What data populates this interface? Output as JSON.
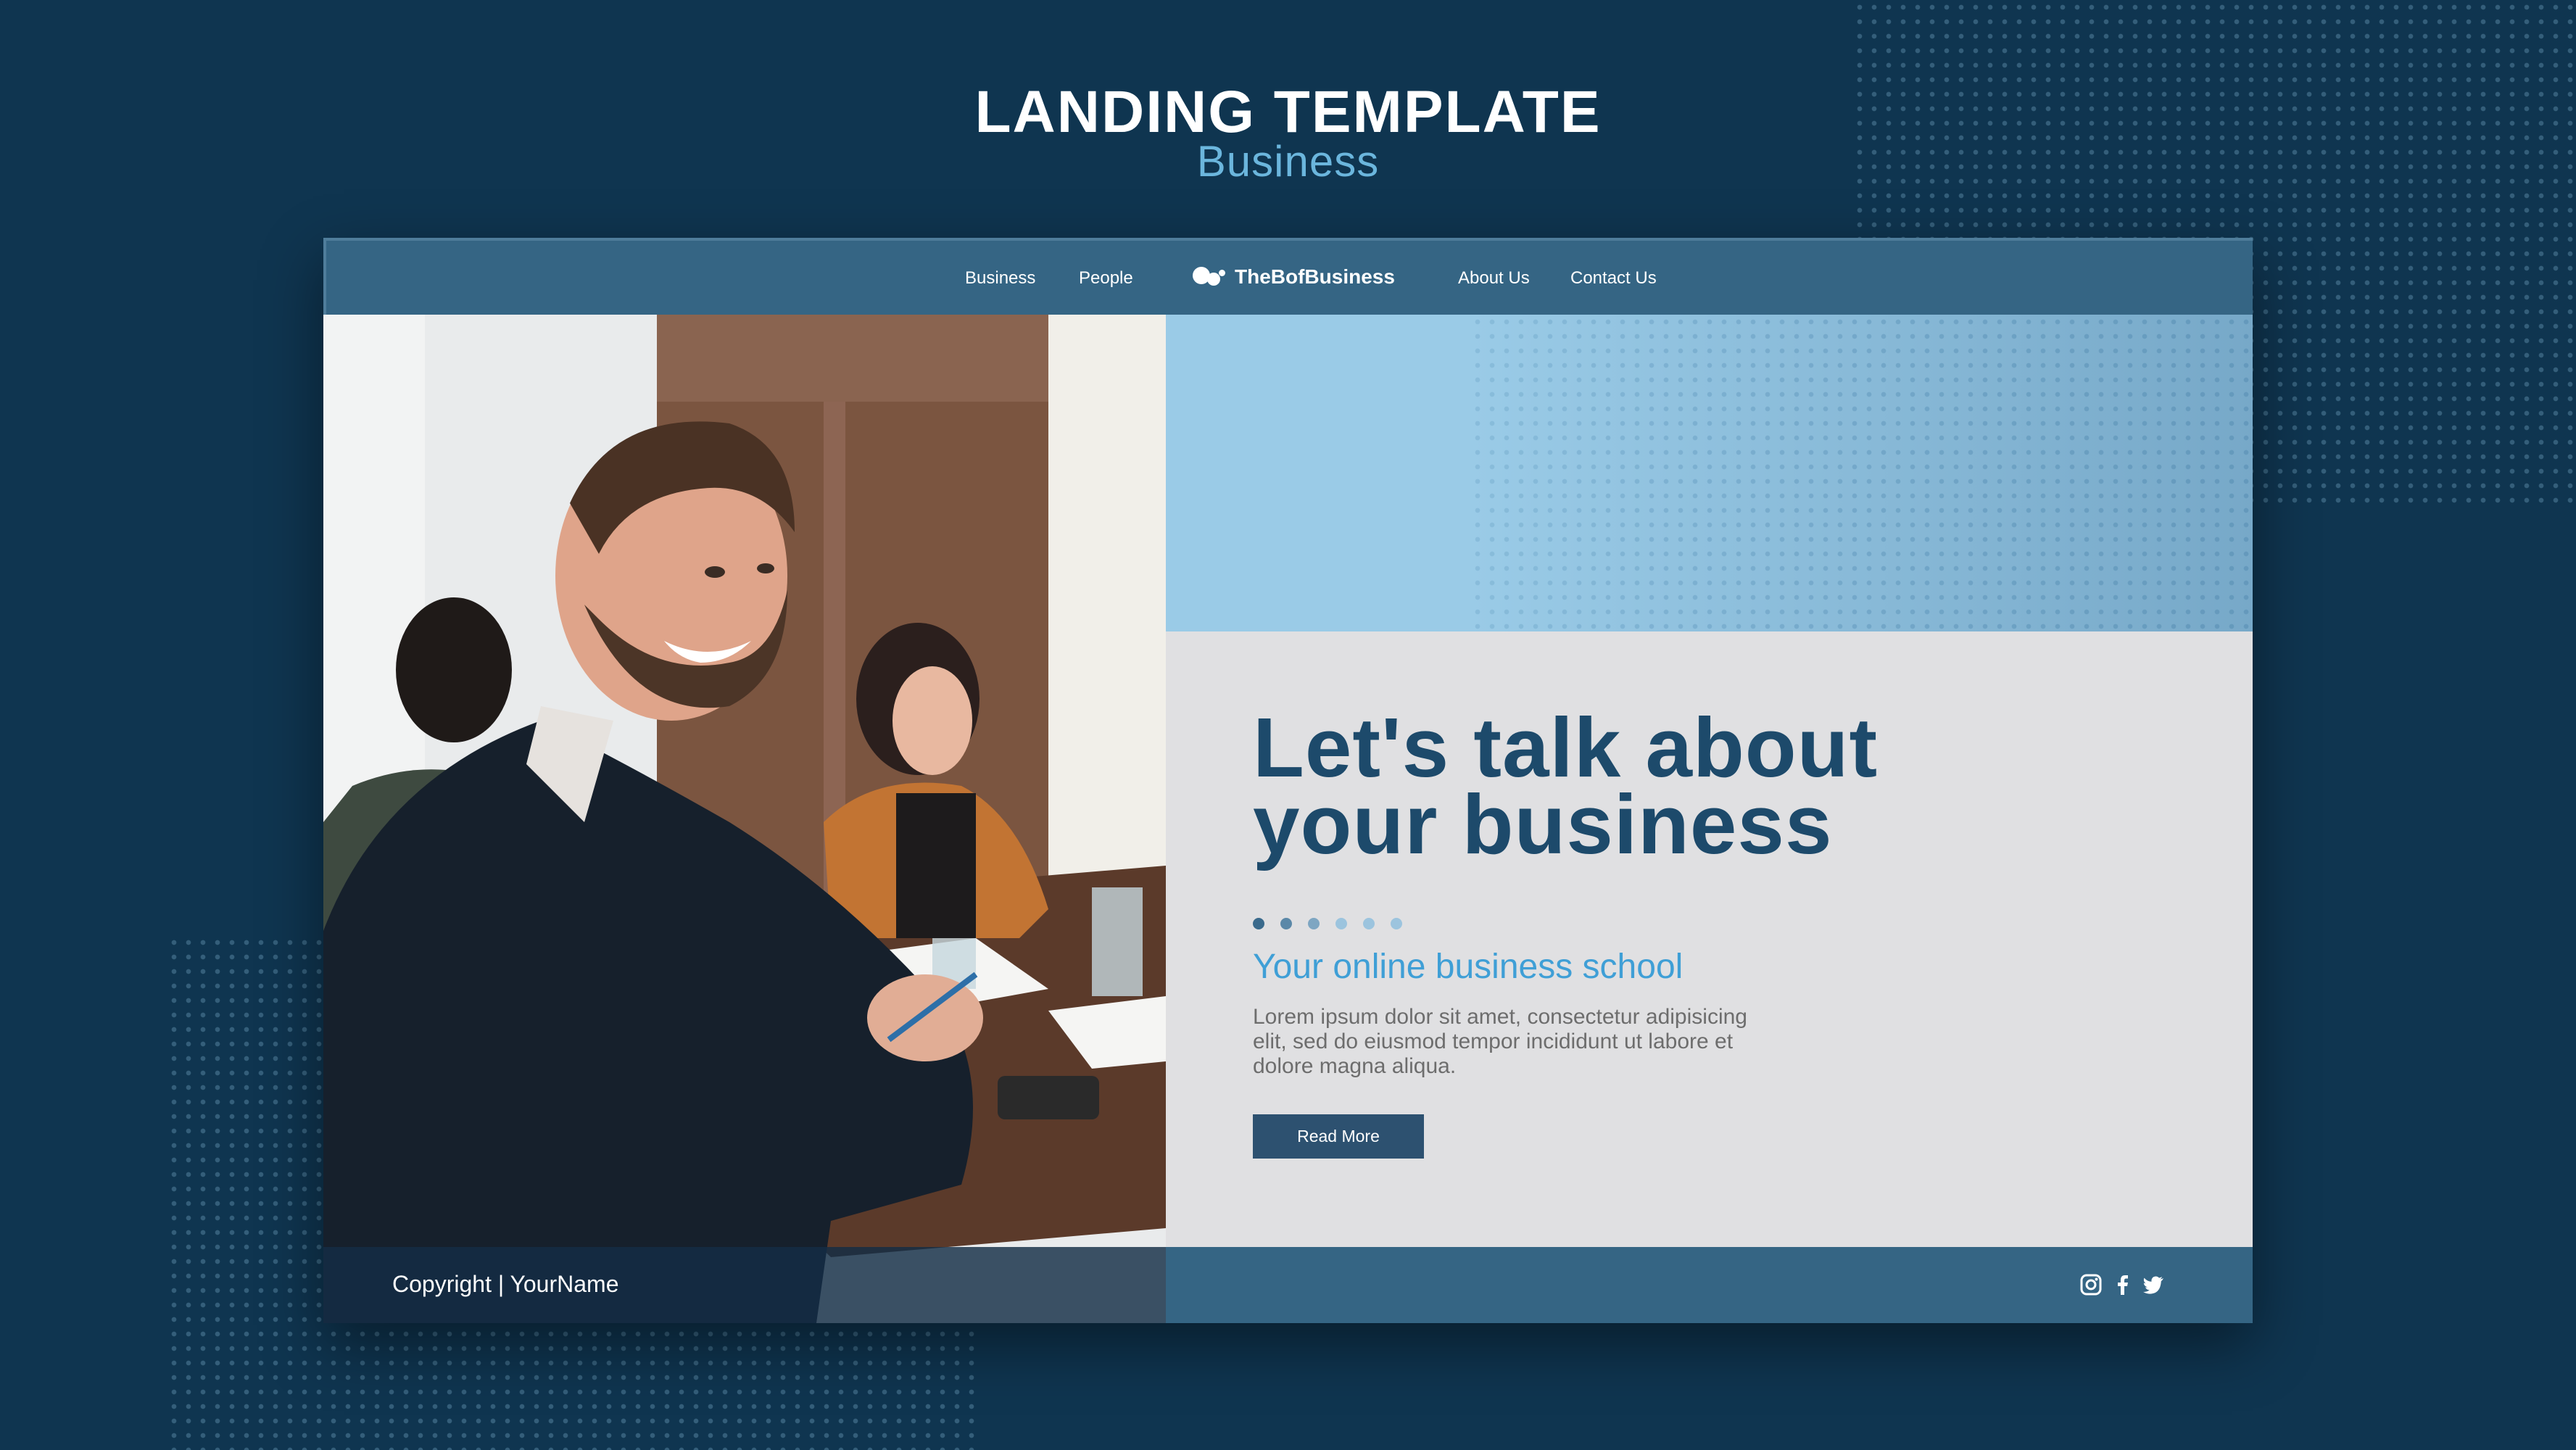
{
  "header": {
    "title": "LANDING TEMPLATE",
    "subtitle": "Business"
  },
  "nav": {
    "links_left": [
      "Business",
      "People"
    ],
    "brand": "TheBofBusiness",
    "links_right": [
      "About Us",
      "Contact Us"
    ]
  },
  "hero": {
    "title_line1": "Let's talk about",
    "title_line2": "your business",
    "subtitle": "Your online business school",
    "body": "Lorem ipsum dolor sit amet, consectetur adipisicing elit, sed do eiusmod tempor incididunt ut labore et dolore magna aliqua.",
    "button_label": "Read More",
    "pagination": {
      "total": 6,
      "active": 1
    }
  },
  "footer": {
    "copyright": "Copyright | YourName",
    "social_icons": [
      "instagram-icon",
      "facebook-icon",
      "twitter-icon"
    ]
  },
  "colors": {
    "background": "#0f3550",
    "nav_bar": "#356584",
    "accent_light_blue": "#9acbe7",
    "heading": "#1d4a6b",
    "subtitle": "#3f9fd6",
    "button": "#2d5170"
  }
}
